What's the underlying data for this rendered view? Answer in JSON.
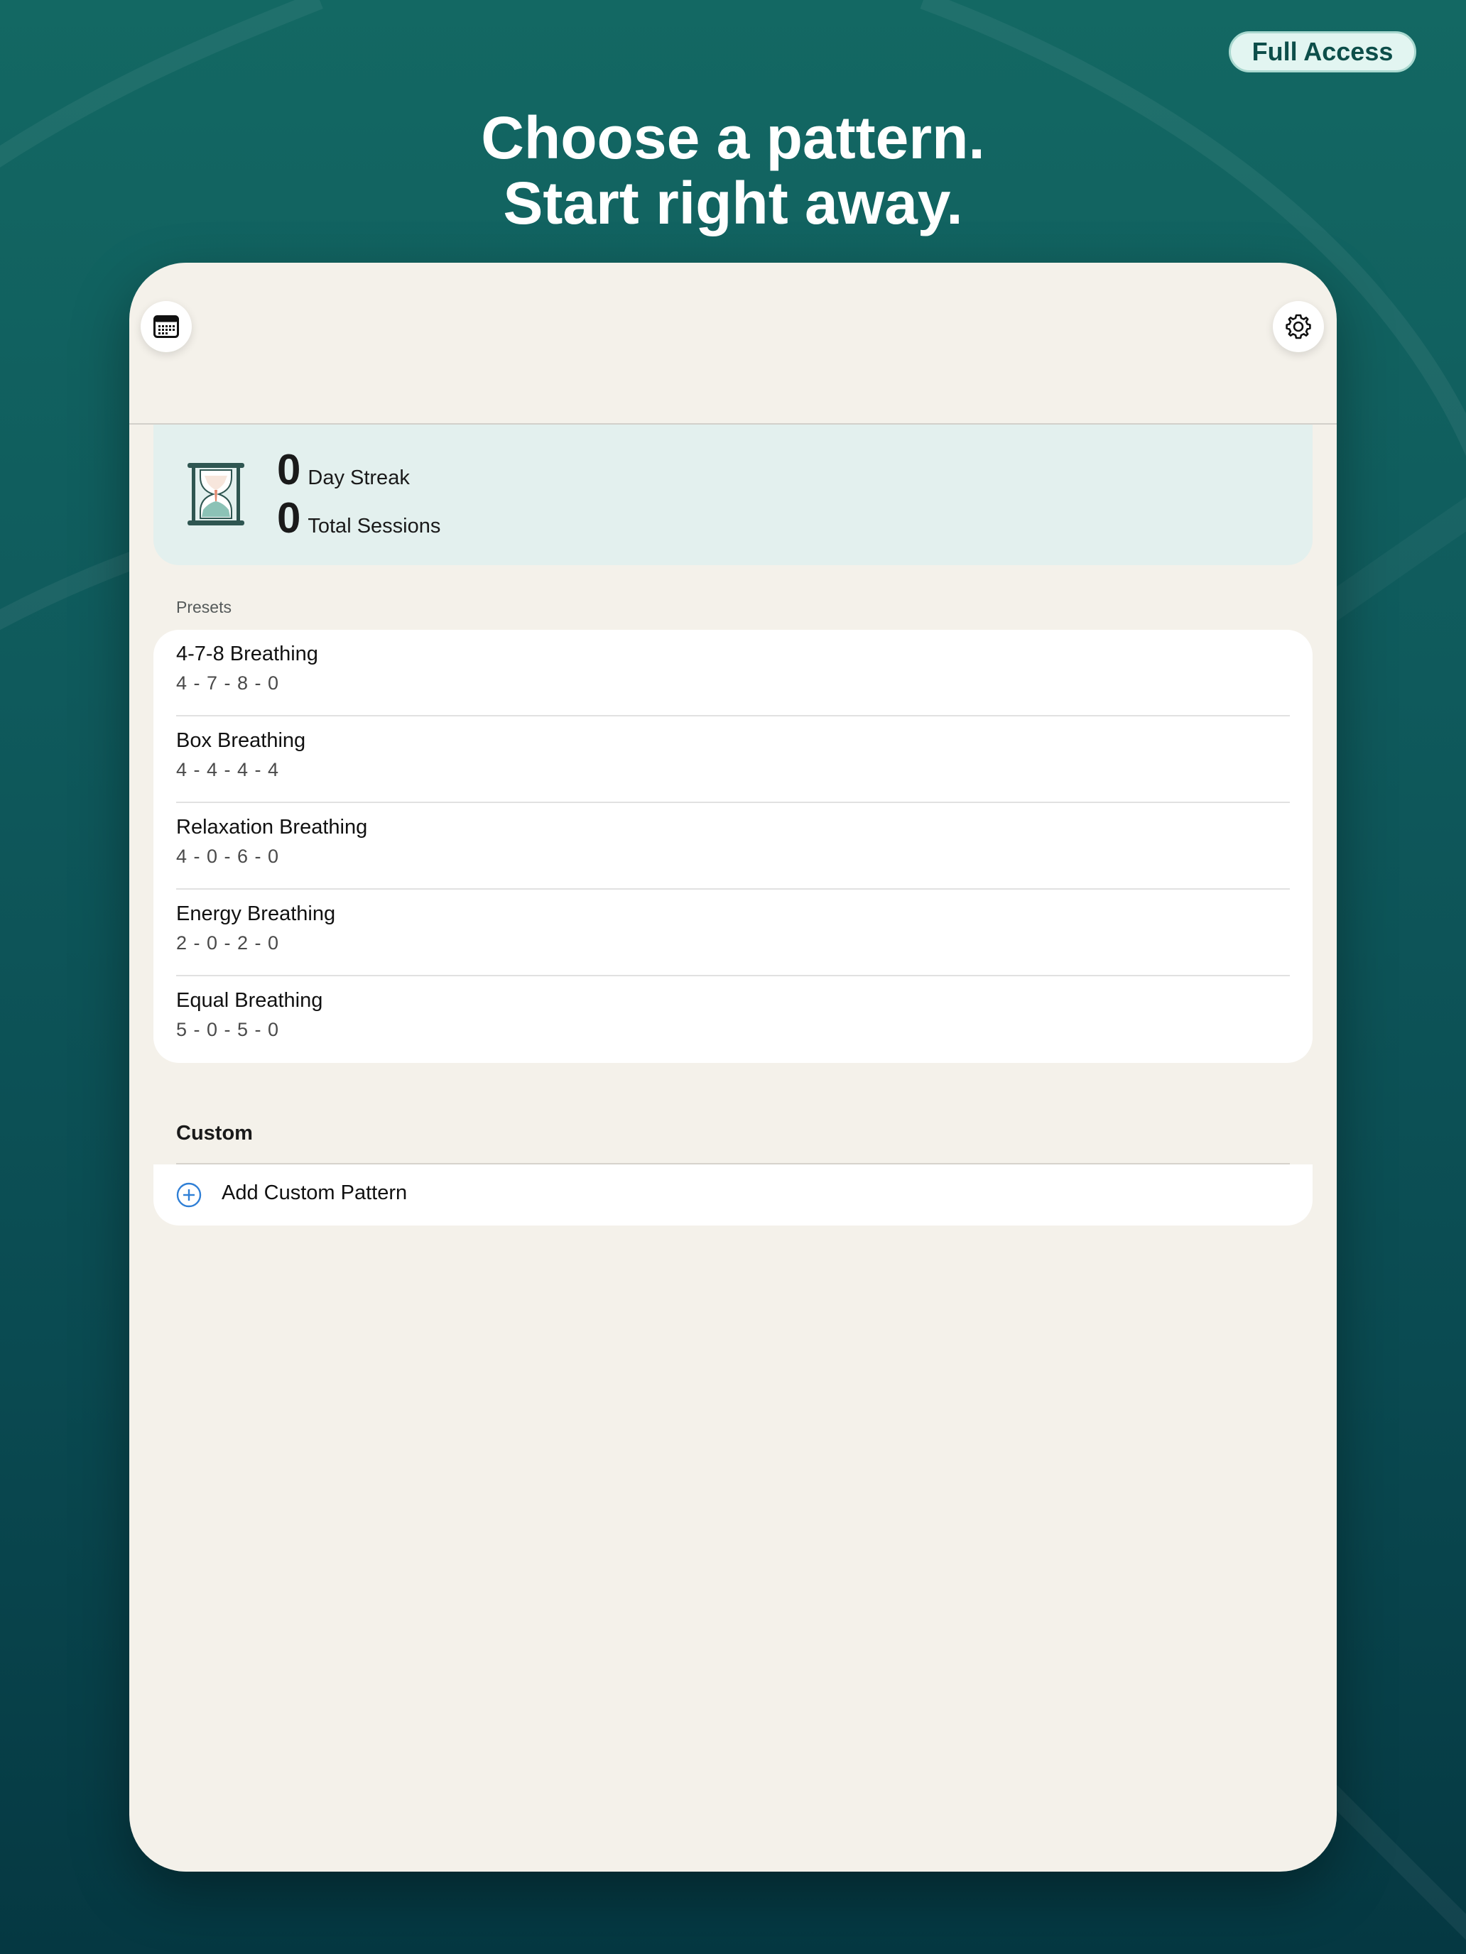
{
  "badge": {
    "label": "Full Access"
  },
  "headline": {
    "line1": "Choose a pattern.",
    "line2": "Start right away."
  },
  "nav": {
    "left_icon": "calendar-icon",
    "right_icon": "gear-icon"
  },
  "stats": {
    "icon": "hourglass-icon",
    "streak_value": "0",
    "streak_label": "Day Streak",
    "sessions_value": "0",
    "sessions_label": "Total Sessions"
  },
  "presets": {
    "label": "Presets",
    "items": [
      {
        "name": "4-7-8 Breathing",
        "pattern": "4 - 7 - 8 - 0"
      },
      {
        "name": "Box Breathing",
        "pattern": "4 - 4 - 4 - 4"
      },
      {
        "name": "Relaxation Breathing",
        "pattern": "4 - 0 - 6 - 0"
      },
      {
        "name": "Energy Breathing",
        "pattern": "2 - 0 - 2 - 0"
      },
      {
        "name": "Equal Breathing",
        "pattern": "5 - 0 - 5 - 0"
      }
    ]
  },
  "custom": {
    "label": "Custom",
    "add_label": "Add Custom Pattern",
    "add_icon": "plus-circle-icon"
  },
  "colors": {
    "background": "#0f5a5c",
    "screen": "#f4f1ea",
    "stats_card": "#e3f0ee",
    "accent_blue": "#2f7fd6",
    "badge": "#e2f5f1"
  }
}
